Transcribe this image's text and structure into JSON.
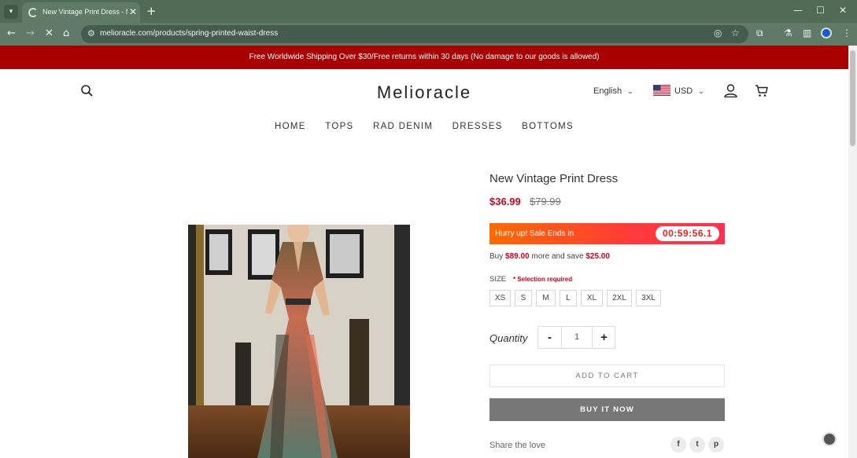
{
  "browser": {
    "tab_title": "New Vintage Print Dress - Meli…",
    "url": "melioracle.com/products/spring-printed-waist-dress"
  },
  "announcement": "Free Worldwide Shipping Over $30/Free returns within 30 days (No damage to our goods is allowed)",
  "header": {
    "logo": "Melioracle",
    "language": "English",
    "currency": "USD"
  },
  "nav": [
    "HOME",
    "TOPS",
    "RAD DENIM",
    "DRESSES",
    "BOTTOMS"
  ],
  "product": {
    "title": "New Vintage Print Dress",
    "price": "$36.99",
    "compare_price": "$79.99",
    "sale_text": "Hurry up! Sale Ends in",
    "countdown": "00:59:56.1",
    "bundle_prefix": "Buy",
    "bundle_amount": "$89.00",
    "bundle_middle": "more and save",
    "bundle_save": "$25.00",
    "size_label": "SIZE",
    "size_required": "* Selection required",
    "sizes": [
      "XS",
      "S",
      "M",
      "L",
      "XL",
      "2XL",
      "3XL"
    ],
    "quantity_label": "Quantity",
    "quantity_minus": "-",
    "quantity_value": "1",
    "quantity_plus": "+",
    "add_to_cart": "ADD TO CART",
    "buy_now": "BUY IT NOW",
    "share_label": "Share the love"
  },
  "colors": {
    "announcement_bg": "#a80000",
    "price": "#d0021b",
    "browser_frame": "#4f6b56"
  }
}
